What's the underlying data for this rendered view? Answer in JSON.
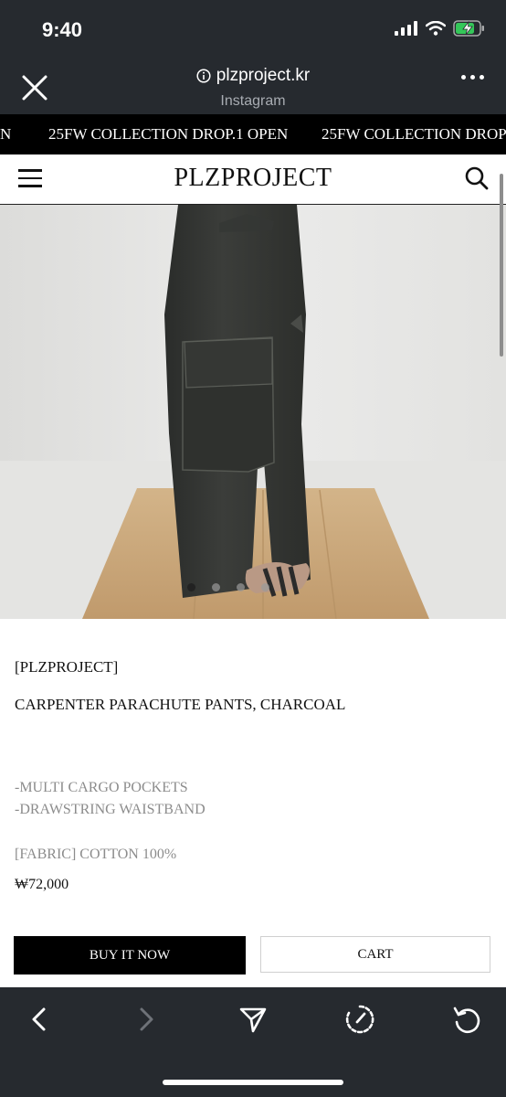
{
  "status_bar": {
    "time": "9:40"
  },
  "browser": {
    "url": "plzproject.kr",
    "source": "Instagram"
  },
  "marquee": {
    "items": [
      "N",
      "25FW COLLECTION DROP.1 OPEN",
      "25FW COLLECTION DROP"
    ]
  },
  "site": {
    "logo": "PLZPROJECT"
  },
  "gallery": {
    "slide_count": 4,
    "active_slide": 1
  },
  "product": {
    "brand": "[PLZPROJECT]",
    "name": "CARPENTER PARACHUTE PANTS, CHARCOAL",
    "features": [
      "-MULTI CARGO POCKETS",
      "-DRAWSTRING WAISTBAND"
    ],
    "fabric": "[FABRIC] COTTON 100%",
    "price": "₩72,000"
  },
  "actions": {
    "buy_now": "BUY IT NOW",
    "cart": "CART"
  },
  "colors": {
    "browser_chrome": "#262a2f",
    "battery": "#34c759",
    "accent": "#000000"
  }
}
